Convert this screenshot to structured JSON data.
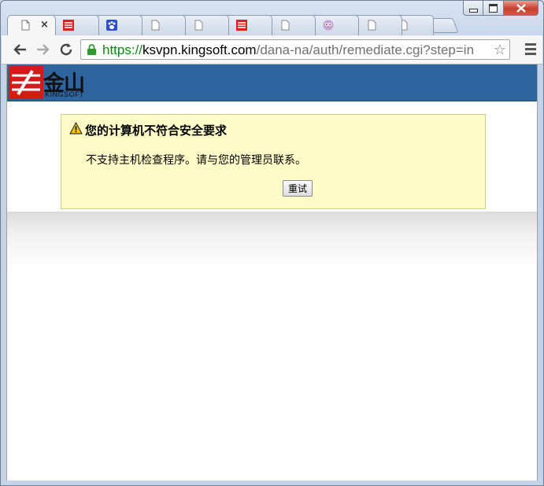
{
  "browser": {
    "tabs": [
      {
        "favicon": "page-icon",
        "active": true,
        "close_label": "×"
      },
      {
        "favicon": "kingsoft-icon"
      },
      {
        "favicon": "baidu-paw-icon"
      },
      {
        "favicon": "page-icon"
      },
      {
        "favicon": "page-icon"
      },
      {
        "favicon": "kingsoft-icon"
      },
      {
        "favicon": "page-icon"
      },
      {
        "favicon": "owl-icon"
      },
      {
        "favicon": "page-icon"
      },
      {
        "favicon": "page-icon"
      }
    ],
    "address": {
      "scheme": "https://",
      "host": "ksvpn.kingsoft.com",
      "path": "/dana-na/auth/remediate.cgi?step=in"
    },
    "star_glyph": "☆"
  },
  "header": {
    "logo_text": "金山",
    "logo_sub": "KINGSOFT"
  },
  "alert": {
    "title": "您的计算机不符合安全要求",
    "message": "不支持主机检查程序。请与您的管理员联系。",
    "retry_label": "重试"
  },
  "colors": {
    "header_bg": "#2f659f",
    "alert_bg": "#fefdc8",
    "alert_border": "#cfcf80",
    "secure_green": "#0a8a0a"
  }
}
